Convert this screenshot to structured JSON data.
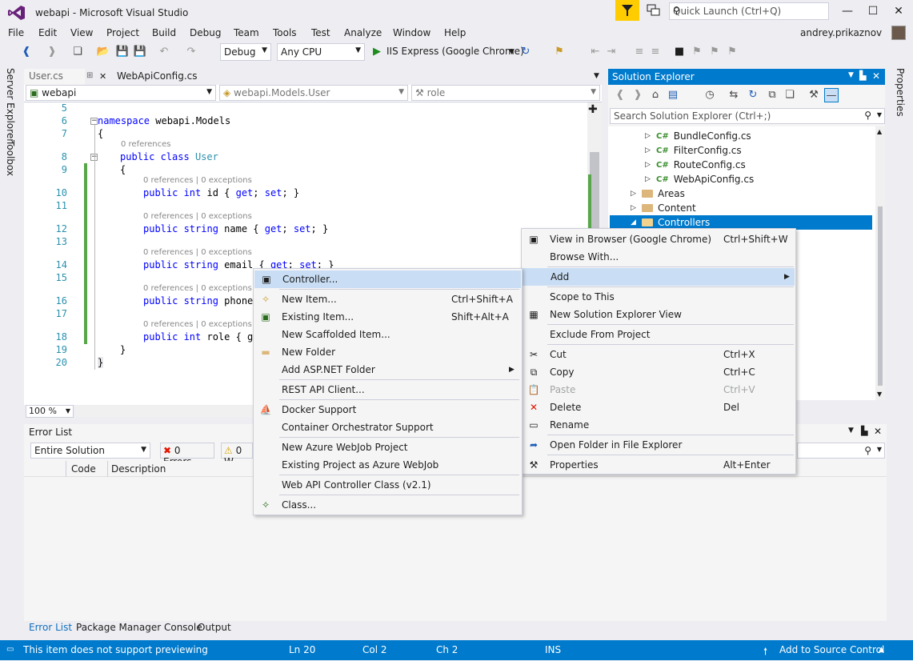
{
  "window": {
    "title": "webapi - Microsoft Visual Studio",
    "quick_launch_placeholder": "Quick Launch (Ctrl+Q)",
    "user": "andrey.prikaznov"
  },
  "menu": [
    "File",
    "Edit",
    "View",
    "Project",
    "Build",
    "Debug",
    "Team",
    "Tools",
    "Test",
    "Analyze",
    "Window",
    "Help"
  ],
  "toolbar": {
    "config": "Debug",
    "platform": "Any CPU",
    "run_label": "IIS Express (Google Chrome)"
  },
  "left_tools": [
    "Server Explorer",
    "Toolbox"
  ],
  "right_tools": [
    "Properties"
  ],
  "editor": {
    "tabs": [
      "User.cs",
      "WebApiConfig.cs"
    ],
    "nav": {
      "project": "webapi",
      "type": "webapi.Models.User",
      "member": "role"
    },
    "zoom": "100 %",
    "lines": [
      {
        "n": "5",
        "text": ""
      },
      {
        "n": "6",
        "text": "namespace webapi.Models"
      },
      {
        "n": "7",
        "text": "{"
      },
      {
        "n": "8",
        "text": "public class User",
        "lens": "0 references"
      },
      {
        "n": "9",
        "text": "{"
      },
      {
        "n": "10",
        "text": "public int id { get; set; }",
        "lens": "0 references | 0 exceptions"
      },
      {
        "n": "11",
        "text": ""
      },
      {
        "n": "12",
        "text": "public string name { get; set; }",
        "lens": "0 references | 0 exceptions"
      },
      {
        "n": "13",
        "text": ""
      },
      {
        "n": "14",
        "text": "public string email { get; set; }",
        "lens": "0 references | 0 exceptions"
      },
      {
        "n": "15",
        "text": ""
      },
      {
        "n": "16",
        "text": "public string phone",
        "lens": "0 references | 0 exceptions"
      },
      {
        "n": "17",
        "text": ""
      },
      {
        "n": "18",
        "text": "public int role { ge",
        "lens": "0 references | 0 exceptions"
      },
      {
        "n": "19",
        "text": "}"
      },
      {
        "n": "20",
        "text": "}"
      }
    ]
  },
  "error_list": {
    "title": "Error List",
    "scope": "Entire Solution",
    "errors": "0 Errors",
    "warnings": "0 W",
    "columns": [
      "Code",
      "Description"
    ],
    "tabs": [
      "Error List",
      "Package Manager Console",
      "Output"
    ]
  },
  "solution_explorer": {
    "title": "Solution Explorer",
    "search_placeholder": "Search Solution Explorer (Ctrl+;)",
    "items": [
      {
        "label": "BundleConfig.cs",
        "kind": "cs"
      },
      {
        "label": "FilterConfig.cs",
        "kind": "cs"
      },
      {
        "label": "RouteConfig.cs",
        "kind": "cs"
      },
      {
        "label": "WebApiConfig.cs",
        "kind": "cs"
      },
      {
        "label": "Areas",
        "kind": "folder"
      },
      {
        "label": "Content",
        "kind": "folder"
      },
      {
        "label": "Controllers",
        "kind": "folder",
        "selected": true
      }
    ]
  },
  "context_menu": [
    {
      "label": "View in Browser (Google Chrome)",
      "shortcut": "Ctrl+Shift+W",
      "icon": "browser-icon"
    },
    {
      "label": "Browse With...",
      "shortcut": ""
    },
    {
      "label": "Add",
      "shortcut": "",
      "submenu": true
    },
    {
      "label": "Scope to This",
      "shortcut": ""
    },
    {
      "label": "New Solution Explorer View",
      "shortcut": "",
      "icon": "new-view-icon"
    },
    {
      "label": "Exclude From Project",
      "shortcut": ""
    },
    {
      "label": "Cut",
      "shortcut": "Ctrl+X",
      "icon": "cut-icon"
    },
    {
      "label": "Copy",
      "shortcut": "Ctrl+C",
      "icon": "copy-icon"
    },
    {
      "label": "Paste",
      "shortcut": "Ctrl+V",
      "icon": "paste-icon",
      "disabled": true
    },
    {
      "label": "Delete",
      "shortcut": "Del",
      "icon": "delete-icon"
    },
    {
      "label": "Rename",
      "shortcut": "",
      "icon": "rename-icon"
    },
    {
      "label": "Open Folder in File Explorer",
      "shortcut": "",
      "icon": "open-folder-icon"
    },
    {
      "label": "Properties",
      "shortcut": "Alt+Enter",
      "icon": "wrench-icon"
    }
  ],
  "add_submenu": [
    {
      "label": "Controller...",
      "shortcut": "",
      "icon": "controller-icon"
    },
    {
      "label": "New Item...",
      "shortcut": "Ctrl+Shift+A",
      "icon": "new-item-icon"
    },
    {
      "label": "Existing Item...",
      "shortcut": "Shift+Alt+A",
      "icon": "existing-item-icon"
    },
    {
      "label": "New Scaffolded Item...",
      "shortcut": ""
    },
    {
      "label": "New Folder",
      "shortcut": "",
      "icon": "new-folder-icon"
    },
    {
      "label": "Add ASP.NET Folder",
      "shortcut": "",
      "submenu": true
    },
    {
      "label": "REST API Client...",
      "shortcut": ""
    },
    {
      "label": "Docker Support",
      "shortcut": "",
      "icon": "docker-icon"
    },
    {
      "label": "Container Orchestrator Support",
      "shortcut": ""
    },
    {
      "label": "New Azure WebJob Project",
      "shortcut": ""
    },
    {
      "label": "Existing Project as Azure WebJob",
      "shortcut": ""
    },
    {
      "label": "Web API Controller Class (v2.1)",
      "shortcut": ""
    },
    {
      "label": "Class...",
      "shortcut": "",
      "icon": "class-icon"
    }
  ],
  "status": {
    "message": "This item does not support previewing",
    "line": "Ln 20",
    "col": "Col 2",
    "ch": "Ch 2",
    "mode": "INS",
    "source_control": "Add to Source Control"
  },
  "colors": {
    "accent": "#007ACC",
    "highlight": "#C9DEF5",
    "menu_bg": "#F5F5F5",
    "ide_bg": "#EEEEF2"
  }
}
